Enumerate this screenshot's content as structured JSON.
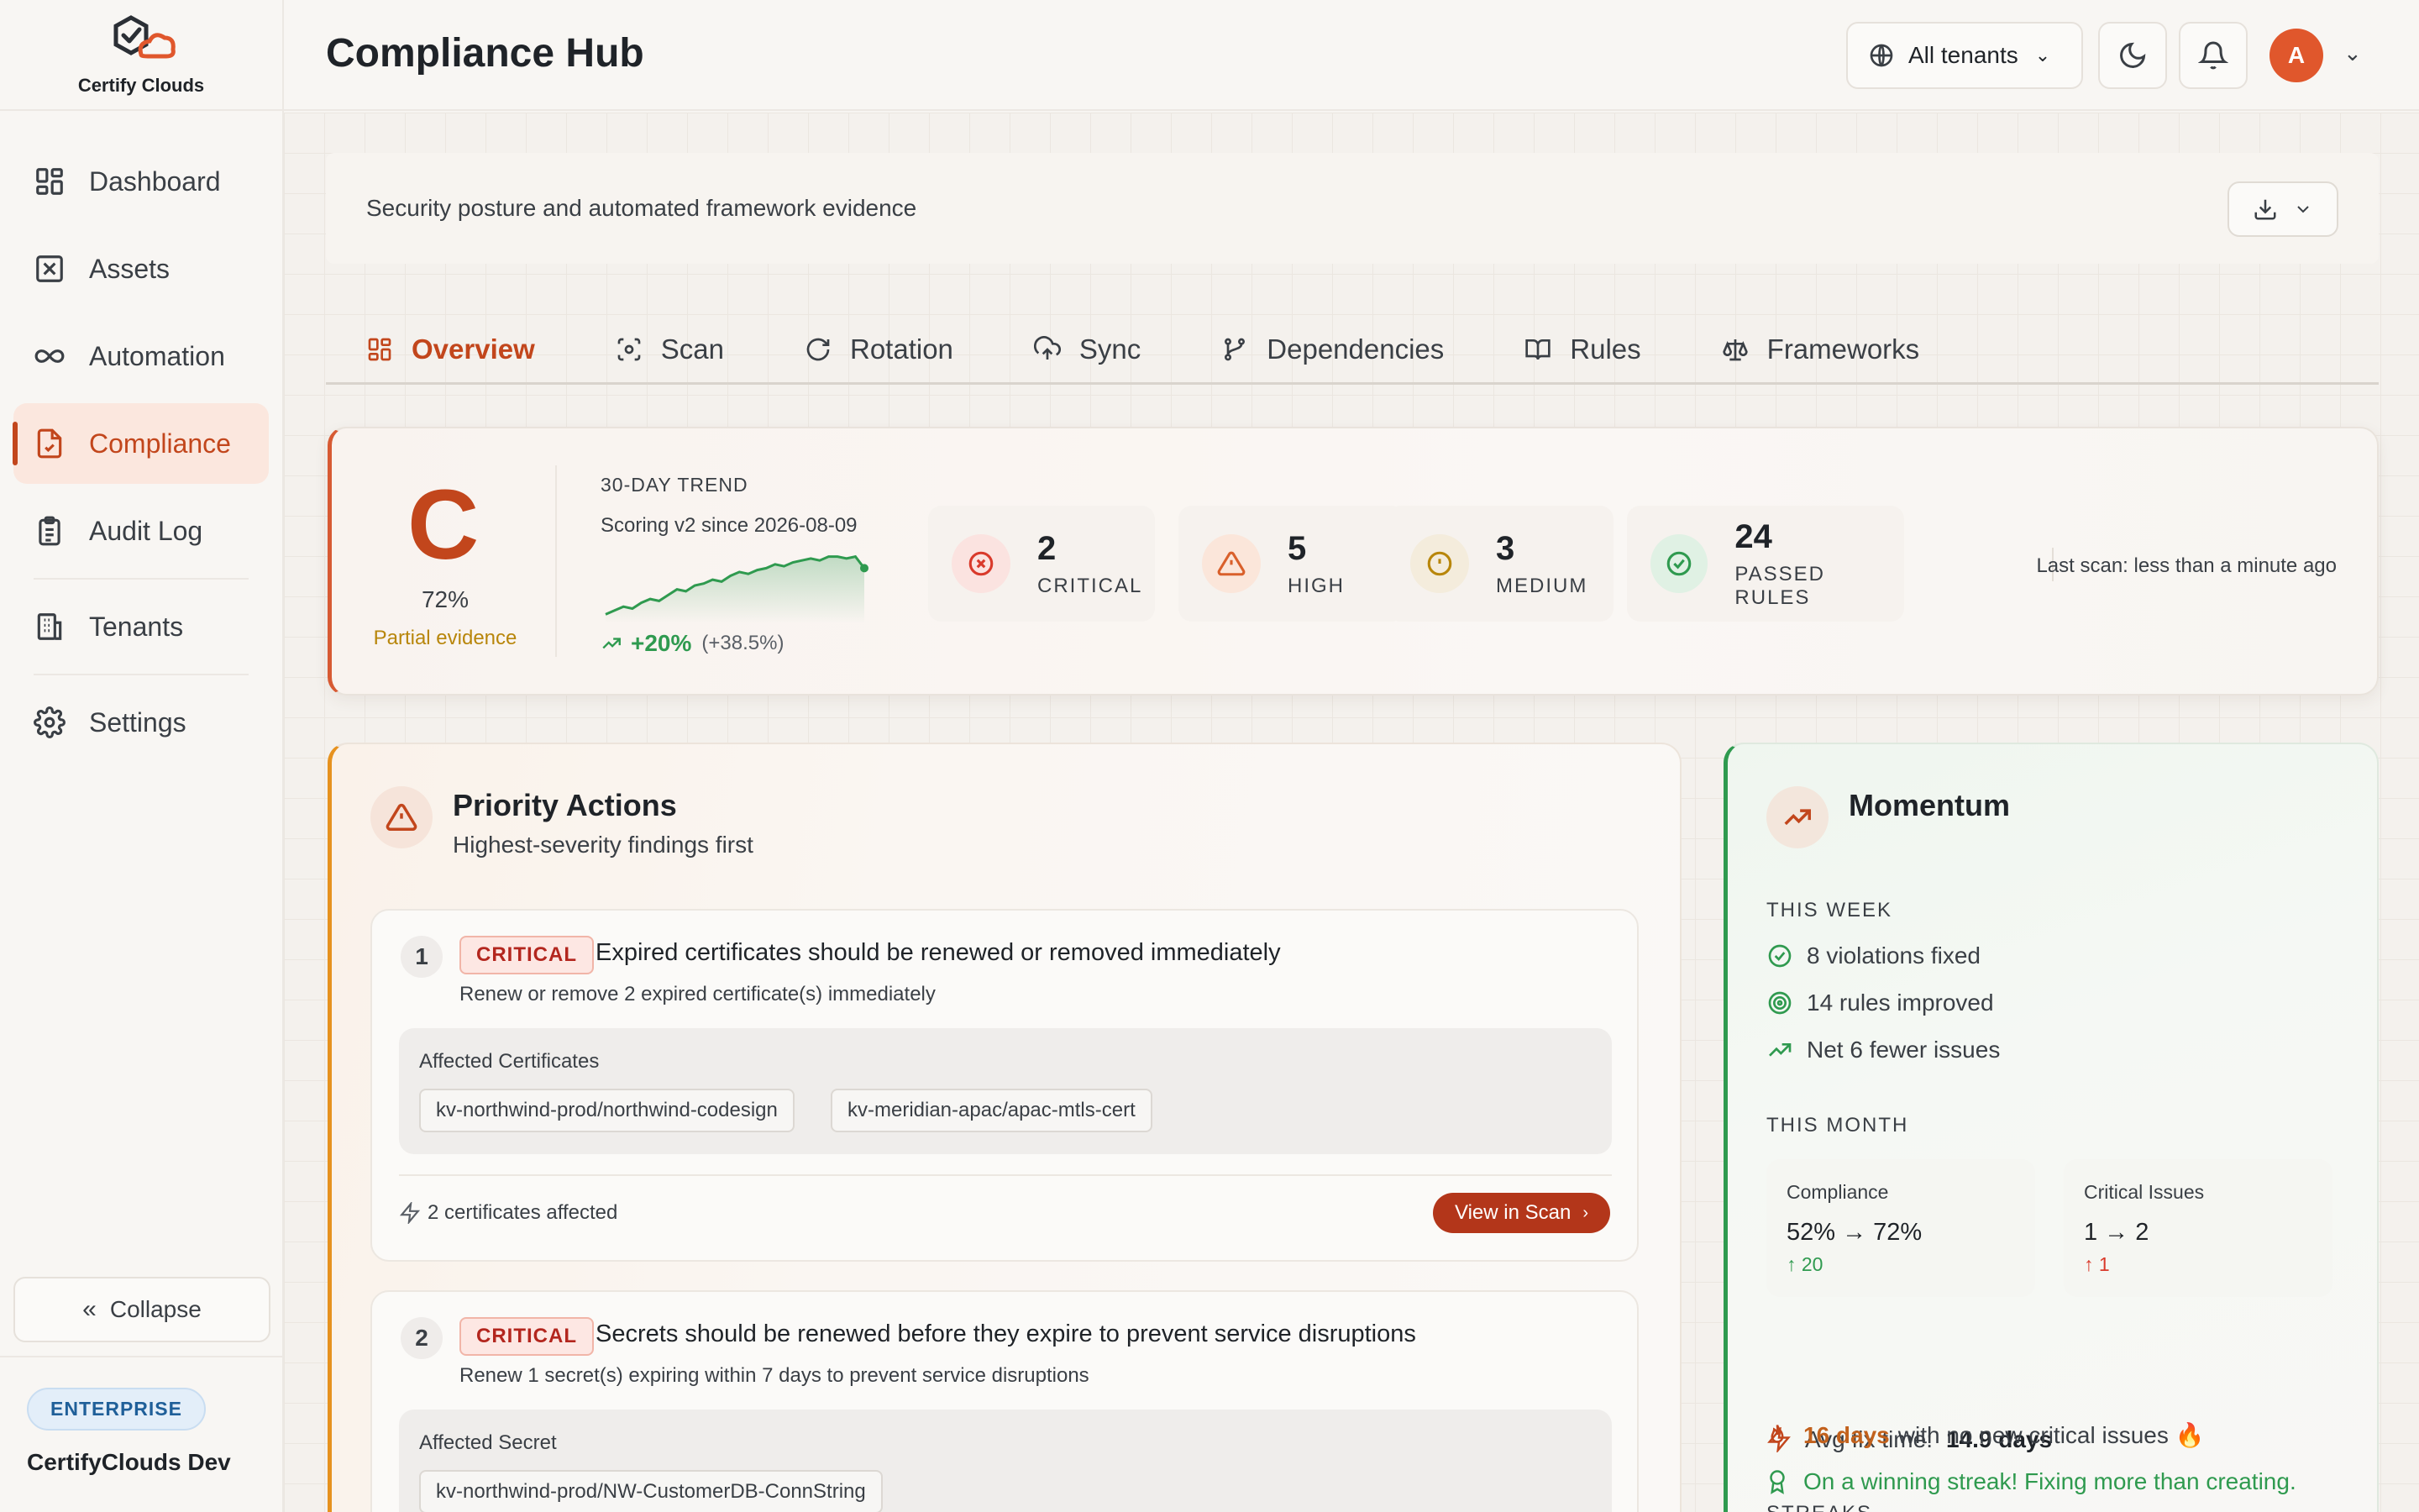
{
  "brand": {
    "name": "Certify Clouds"
  },
  "sidebar": {
    "items": [
      {
        "label": "Dashboard",
        "icon": "dashboard-icon"
      },
      {
        "label": "Assets",
        "icon": "assets-icon"
      },
      {
        "label": "Automation",
        "icon": "infinity-icon"
      },
      {
        "label": "Compliance",
        "icon": "file-check-icon",
        "active": true
      },
      {
        "label": "Audit Log",
        "icon": "clipboard-icon"
      },
      {
        "label": "Tenants",
        "icon": "building-icon"
      },
      {
        "label": "Settings",
        "icon": "gear-icon"
      }
    ],
    "collapse_label": "Collapse",
    "plan_badge": "ENTERPRISE",
    "org_name": "CertifyClouds Dev"
  },
  "header": {
    "title": "Compliance Hub",
    "tenant_select": "All tenants",
    "avatar_initial": "A"
  },
  "main": {
    "subtitle": "Security posture and automated framework evidence",
    "tabs": [
      {
        "label": "Overview",
        "icon": "grid-icon",
        "active": true
      },
      {
        "label": "Scan",
        "icon": "scan-icon"
      },
      {
        "label": "Rotation",
        "icon": "refresh-icon"
      },
      {
        "label": "Sync",
        "icon": "cloud-upload-icon"
      },
      {
        "label": "Dependencies",
        "icon": "git-branch-icon"
      },
      {
        "label": "Rules",
        "icon": "book-icon"
      },
      {
        "label": "Frameworks",
        "icon": "scale-icon"
      }
    ],
    "score": {
      "grade": "C",
      "percent": "72%",
      "label": "Partial evidence",
      "trend_title": "30-DAY TREND",
      "trend_sub": "Scoring v2 since 2026-08-09",
      "trend_delta": "+20%",
      "trend_delta_extra": "(+38.5%)",
      "trend_points": [
        42,
        44,
        46,
        45,
        48,
        50,
        49,
        52,
        55,
        54,
        57,
        58,
        60,
        59,
        62,
        64,
        63,
        65,
        66,
        68,
        67,
        69,
        70,
        71,
        70,
        72,
        72,
        71,
        72,
        66
      ],
      "stats": [
        {
          "value": "2",
          "label": "CRITICAL",
          "color": "#d93a2b"
        },
        {
          "value": "5",
          "label": "HIGH",
          "color": "#d9602b"
        },
        {
          "value": "3",
          "label": "MEDIUM",
          "color": "#b8860b"
        },
        {
          "value": "24",
          "label": "PASSED RULES",
          "color": "#2f9a4f"
        }
      ],
      "last_scan": "Last scan: less than a minute ago"
    },
    "priority": {
      "title": "Priority Actions",
      "subtitle": "Highest-severity findings first",
      "actions": [
        {
          "num": "1",
          "severity": "CRITICAL",
          "title": "Expired certificates should be renewed or removed immediately",
          "desc": "Renew or remove 2 expired certificate(s) immediately",
          "affected_label": "Affected Certificates",
          "chips": [
            "kv-northwind-prod/northwind-codesign",
            "kv-meridian-apac/apac-mtls-cert"
          ],
          "footer": "2 certificates affected",
          "button": "View in Scan"
        },
        {
          "num": "2",
          "severity": "CRITICAL",
          "title": "Secrets should be renewed before they expire to prevent service disruptions",
          "desc": "Renew 1 secret(s) expiring within 7 days to prevent service disruptions",
          "affected_label": "Affected Secret",
          "chips": [
            "kv-northwind-prod/NW-CustomerDB-ConnString"
          ]
        }
      ]
    },
    "momentum": {
      "title": "Momentum",
      "this_week_label": "THIS WEEK",
      "week_items": [
        "8 violations fixed",
        "14 rules improved",
        "Net 6 fewer issues"
      ],
      "this_month_label": "THIS MONTH",
      "month_cards": [
        {
          "label": "Compliance",
          "value": "52% → 72%",
          "delta": "↑ 20",
          "delta_color": "#2f9a4f"
        },
        {
          "label": "Critical Issues",
          "value": "1 → 2",
          "delta": "↑ 1",
          "delta_color": "#d93a2b"
        }
      ],
      "avg_fix_label": "Avg fix time:",
      "avg_fix_value": "14.9 days",
      "streaks_label": "STREAKS",
      "streak_days": "16 days",
      "streak_text": "with no new critical issues 🔥",
      "streak_win": "On a winning streak! Fixing more than creating."
    }
  }
}
